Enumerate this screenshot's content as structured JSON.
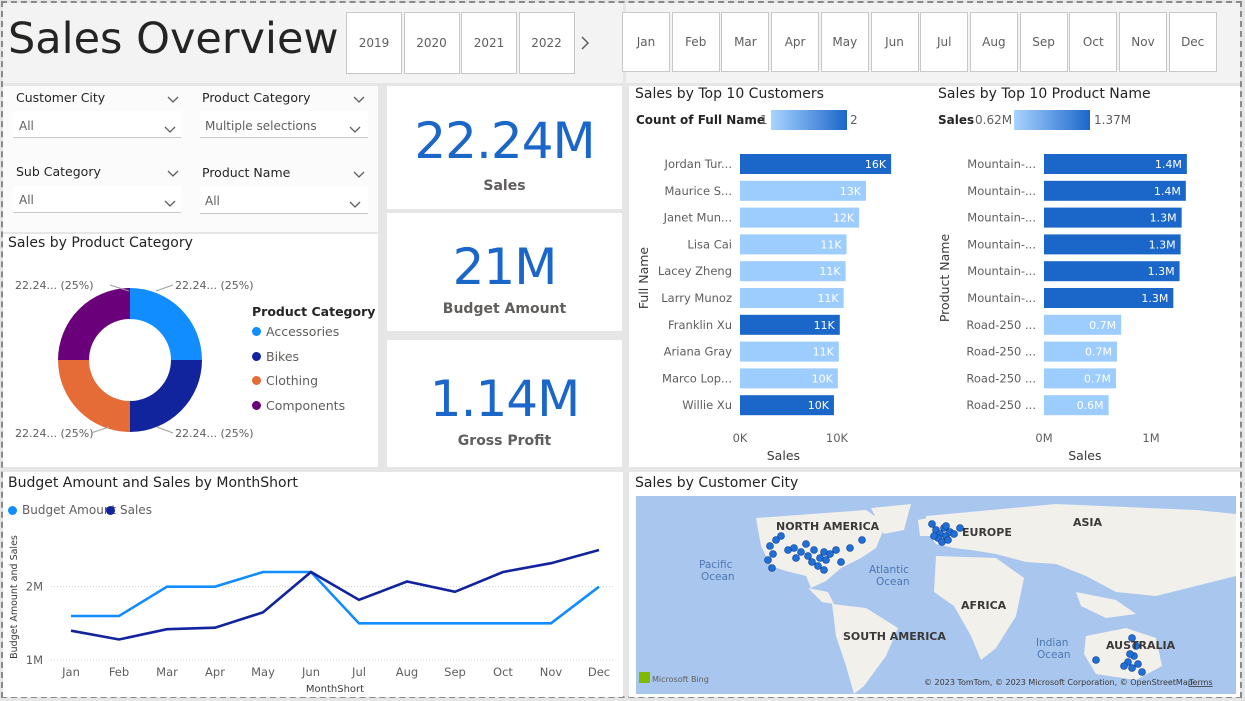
{
  "header": {
    "title": "Sales Overview"
  },
  "year_slicer": {
    "years": [
      "2019",
      "2020",
      "2021",
      "2022"
    ]
  },
  "month_slicer": {
    "months": [
      "Jan",
      "Feb",
      "Mar",
      "Apr",
      "May",
      "Jun",
      "Jul",
      "Aug",
      "Sep",
      "Oct",
      "Nov",
      "Dec"
    ]
  },
  "filters": {
    "customer_city": {
      "label": "Customer City",
      "value": "All"
    },
    "product_category": {
      "label": "Product Category",
      "value": "Multiple selections"
    },
    "sub_category": {
      "label": "Sub Category",
      "value": "All"
    },
    "product_name": {
      "label": "Product Name",
      "value": "All"
    }
  },
  "kpis": {
    "sales": {
      "value": "22.24M",
      "label": "Sales"
    },
    "budget": {
      "value": "21M",
      "label": "Budget Amount"
    },
    "profit": {
      "value": "1.14M",
      "label": "Gross Profit"
    }
  },
  "donut": {
    "title": "Sales by Product Category",
    "legend_title": "Product Category",
    "slice_label": "22.24... (25%)",
    "categories": [
      "Accessories",
      "Bikes",
      "Clothing",
      "Components"
    ],
    "colors": [
      "#118dff",
      "#12239e",
      "#e66c37",
      "#6b007b"
    ]
  },
  "top_customers": {
    "title": "Sales by Top 10 Customers",
    "legend_label": "Count of Full Name",
    "legend_min": "1",
    "legend_max": "2",
    "y_axis_title": "Full Name",
    "x_axis_title": "Sales",
    "x_ticks": [
      "0K",
      "10K"
    ]
  },
  "top_products": {
    "title": "Sales by Top 10 Product Name",
    "legend_label": "Sales",
    "legend_min": "0.62M",
    "legend_max": "1.37M",
    "y_axis_title": "Product Name",
    "x_axis_title": "Sales",
    "x_ticks": [
      "0M",
      "1M"
    ]
  },
  "line_chart": {
    "title": "Budget Amount and Sales by MonthShort",
    "x_axis_title": "MonthShort",
    "y_axis_title": "Budget Amount and Sales",
    "y_ticks": [
      "2M",
      "1M"
    ]
  },
  "map": {
    "title": "Sales by Customer City",
    "labels": [
      "NORTH AMERICA",
      "EUROPE",
      "ASIA",
      "AFRICA",
      "SOUTH AMERICA",
      "AUSTRALIA"
    ],
    "ocean_labels": [
      "Pacific\nOcean",
      "Atlantic\nOcean",
      "Indian\nOcean"
    ],
    "attribution": "© 2023 TomTom, © 2023 Microsoft Corporation, © OpenStreetMap",
    "terms": "Terms",
    "brand": "Microsoft Bing"
  },
  "chart_data": [
    {
      "type": "bar",
      "title": "Sales by Top 10 Customers",
      "categories": [
        "Jordan Tur...",
        "Maurice S...",
        "Janet Mun...",
        "Lisa Cai",
        "Lacey Zheng",
        "Larry Munoz",
        "Franklin Xu",
        "Ariana Gray",
        "Marco Lop...",
        "Willie Xu"
      ],
      "values": [
        15.6,
        13.0,
        12.3,
        11.0,
        10.9,
        10.7,
        10.3,
        10.2,
        10.1,
        9.7
      ],
      "data_labels": [
        "16K",
        "13K",
        "12K",
        "11K",
        "11K",
        "11K",
        "11K",
        "11K",
        "10K",
        "10K"
      ],
      "count_full_name": [
        2,
        1,
        1,
        1,
        1,
        1,
        2,
        1,
        1,
        2
      ],
      "xlabel": "Sales",
      "ylabel": "Full Name",
      "xlim": [
        0,
        16
      ]
    },
    {
      "type": "bar",
      "title": "Sales by Top 10 Product Name",
      "categories": [
        "Mountain-...",
        "Mountain-...",
        "Mountain-...",
        "Mountain-...",
        "Mountain-...",
        "Mountain-...",
        "Road-250 ...",
        "Road-250 ...",
        "Road-250 ...",
        "Road-250 ..."
      ],
      "values": [
        1.37,
        1.36,
        1.32,
        1.31,
        1.3,
        1.24,
        0.74,
        0.7,
        0.69,
        0.62
      ],
      "data_labels": [
        "1.4M",
        "1.4M",
        "1.3M",
        "1.3M",
        "1.3M",
        "1.3M",
        "0.7M",
        "0.7M",
        "0.7M",
        "0.6M"
      ],
      "xlabel": "Sales",
      "ylabel": "Product Name",
      "xlim": [
        0,
        1.4
      ]
    },
    {
      "type": "line",
      "title": "Budget Amount and Sales by MonthShort",
      "categories": [
        "Jan",
        "Feb",
        "Mar",
        "Apr",
        "May",
        "Jun",
        "Jul",
        "Aug",
        "Sep",
        "Oct",
        "Nov",
        "Dec"
      ],
      "series": [
        {
          "name": "Budget Amount",
          "color": "#118dff",
          "values": [
            1.6,
            1.6,
            2.0,
            2.0,
            2.2,
            2.2,
            1.5,
            1.5,
            1.5,
            1.5,
            1.5,
            2.0
          ]
        },
        {
          "name": "Sales",
          "color": "#12239e",
          "values": [
            1.4,
            1.28,
            1.42,
            1.44,
            1.65,
            2.2,
            1.82,
            2.07,
            1.93,
            2.2,
            2.32,
            2.5
          ]
        }
      ],
      "xlabel": "MonthShort",
      "ylabel": "Budget Amount and Sales",
      "ylim": [
        1.0,
        2.8
      ]
    },
    {
      "type": "pie",
      "title": "Sales by Product Category",
      "categories": [
        "Accessories",
        "Bikes",
        "Clothing",
        "Components"
      ],
      "values": [
        25,
        25,
        25,
        25
      ]
    }
  ]
}
